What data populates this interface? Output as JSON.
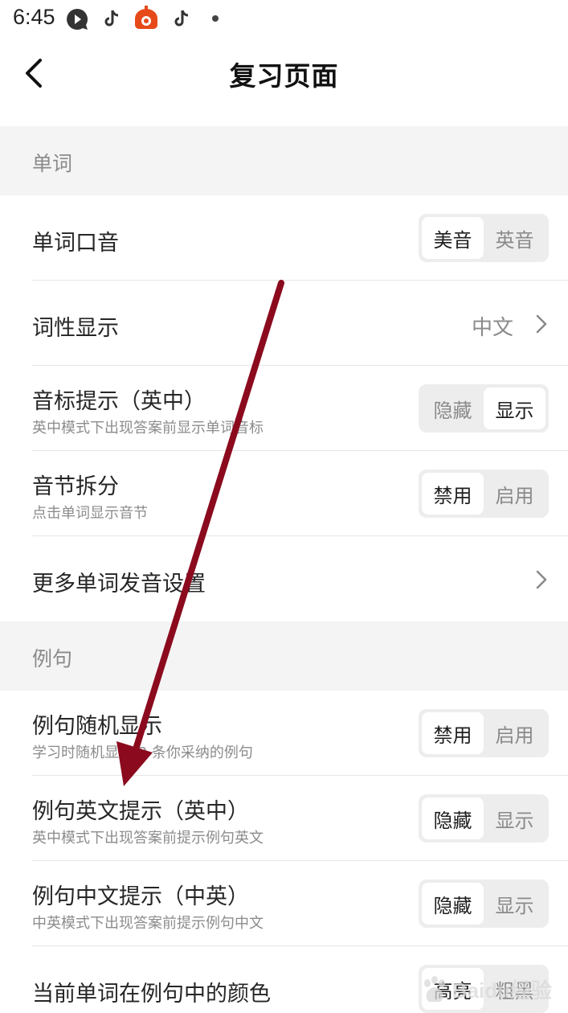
{
  "status_bar": {
    "time": "6:45",
    "icons": [
      "message-bubble-icon",
      "tiktok-icon",
      "tomato-app-icon",
      "tiktok-icon",
      "dot-icon"
    ]
  },
  "header": {
    "title": "复习页面",
    "back_icon": "chevron-left-icon"
  },
  "sections": {
    "words": {
      "title": "单词",
      "accent": {
        "title": "单词口音",
        "options": [
          "美音",
          "英音"
        ],
        "selected": "美音"
      },
      "pos": {
        "title": "词性显示",
        "value": "中文"
      },
      "phonetic": {
        "title": "音标提示（英中）",
        "subtitle": "英中模式下出现答案前显示单词音标",
        "options": [
          "隐藏",
          "显示"
        ],
        "selected": "显示"
      },
      "syllable": {
        "title": "音节拆分",
        "subtitle": "点击单词显示音节",
        "options": [
          "禁用",
          "启用"
        ],
        "selected": "禁用"
      },
      "more": {
        "title": "更多单词发音设置"
      }
    },
    "examples": {
      "title": "例句",
      "random": {
        "title": "例句随机显示",
        "subtitle": "学习时随机显示 3 条你采纳的例句",
        "options": [
          "禁用",
          "启用"
        ],
        "selected": "禁用"
      },
      "en_hint": {
        "title": "例句英文提示（英中）",
        "subtitle": "英中模式下出现答案前提示例句英文",
        "options": [
          "隐藏",
          "显示"
        ],
        "selected": "隐藏"
      },
      "zh_hint": {
        "title": "例句中文提示（中英）",
        "subtitle": "中英模式下出现答案前提示例句中文",
        "options": [
          "隐藏",
          "显示"
        ],
        "selected": "隐藏"
      },
      "color": {
        "title": "当前单词在例句中的颜色",
        "options": [
          "高亮",
          "粗黑"
        ],
        "selected": "高亮"
      }
    }
  },
  "watermark": {
    "text": "Baidu经验"
  },
  "colors": {
    "annotation_arrow": "#8b0a1e",
    "section_bg": "#f4f4f4",
    "segment_bg": "#ededed"
  }
}
